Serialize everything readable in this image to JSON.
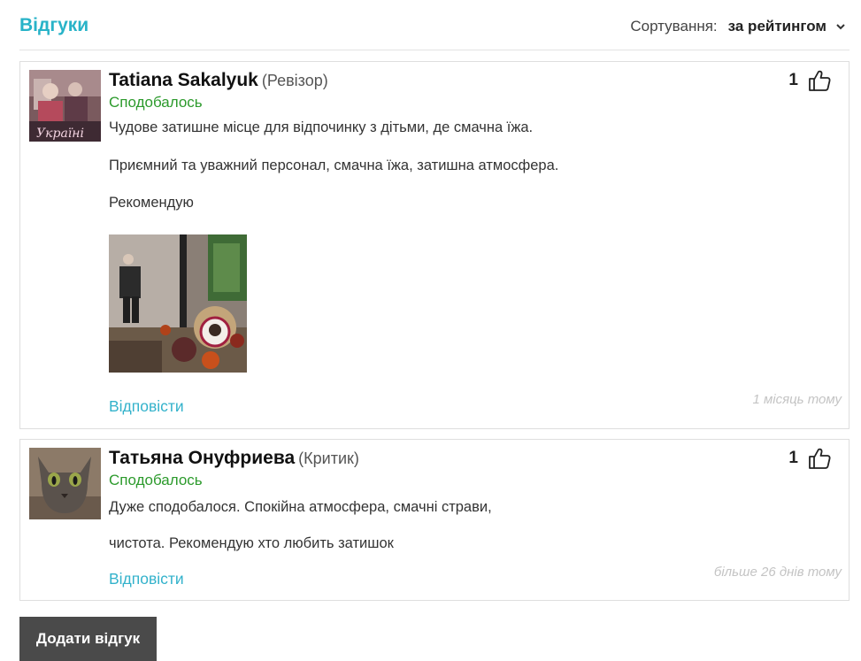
{
  "header": {
    "title": "Відгуки",
    "sort_label": "Сортування:",
    "sort_value": "за рейтингом"
  },
  "reviews": [
    {
      "author": "Tatiana Sakalyuk",
      "rank": "(Ревізор)",
      "status": "Сподобалось",
      "likes": "1",
      "paragraphs": [
        "Чудове затишне місце для відпочинку з дітьми, де смачна їжа.",
        "Приємний та уважний персонал, смачна їжа, затишна атмосфера.",
        "Рекомендую"
      ],
      "reply_label": "Відповісти",
      "date": "1 місяць тому"
    },
    {
      "author": "Татьяна Онуфриева",
      "rank": "(Критик)",
      "status": "Сподобалось",
      "likes": "1",
      "paragraphs": [
        "Дуже сподобалося. Спокійна атмосфера, смачні страви,",
        "чистота. Рекомендую хто любить затишок"
      ],
      "reply_label": "Відповісти",
      "date": "більше 26 днів тому"
    }
  ],
  "add_review_label": "Додати відгук",
  "colors": {
    "accent": "#28b3c8",
    "liked": "#2c9a2c",
    "button": "#4a4a4a"
  }
}
